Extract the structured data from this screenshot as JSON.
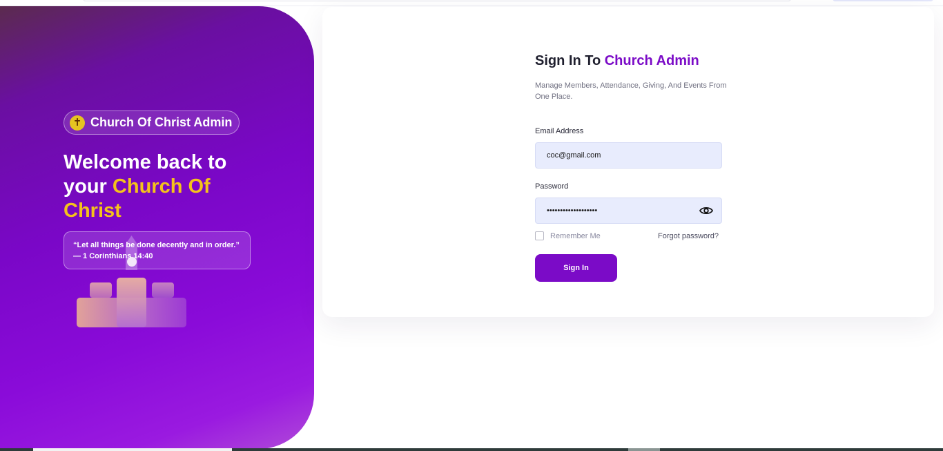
{
  "hero": {
    "brand_name": "Church Of Christ Admin",
    "brand_icon": "cross-icon",
    "headline_part1": "Welcome back to your ",
    "headline_accent": "Church Of Christ",
    "quote": "“Let all things be done decently and in order.” — 1 Corinthians 14:40",
    "accent_color": "#f4c21b",
    "gradient_colors": [
      "#5b2b4e",
      "#7a07c7",
      "#b04ad8"
    ]
  },
  "login": {
    "title_prefix": "Sign In To ",
    "title_accent": "Church Admin",
    "subtitle": "Manage Members, Attendance, Giving, And Events From One Place.",
    "email_label": "Email Address",
    "email_value": "coc@gmail.com",
    "password_label": "Password",
    "password_value": "•••••••••••••••••••",
    "remember_label": "Remember Me",
    "forgot_label": "Forgot password?",
    "submit_label": "Sign In",
    "brand_color": "#7b0bc7",
    "field_bg": "#e8ecfd"
  }
}
